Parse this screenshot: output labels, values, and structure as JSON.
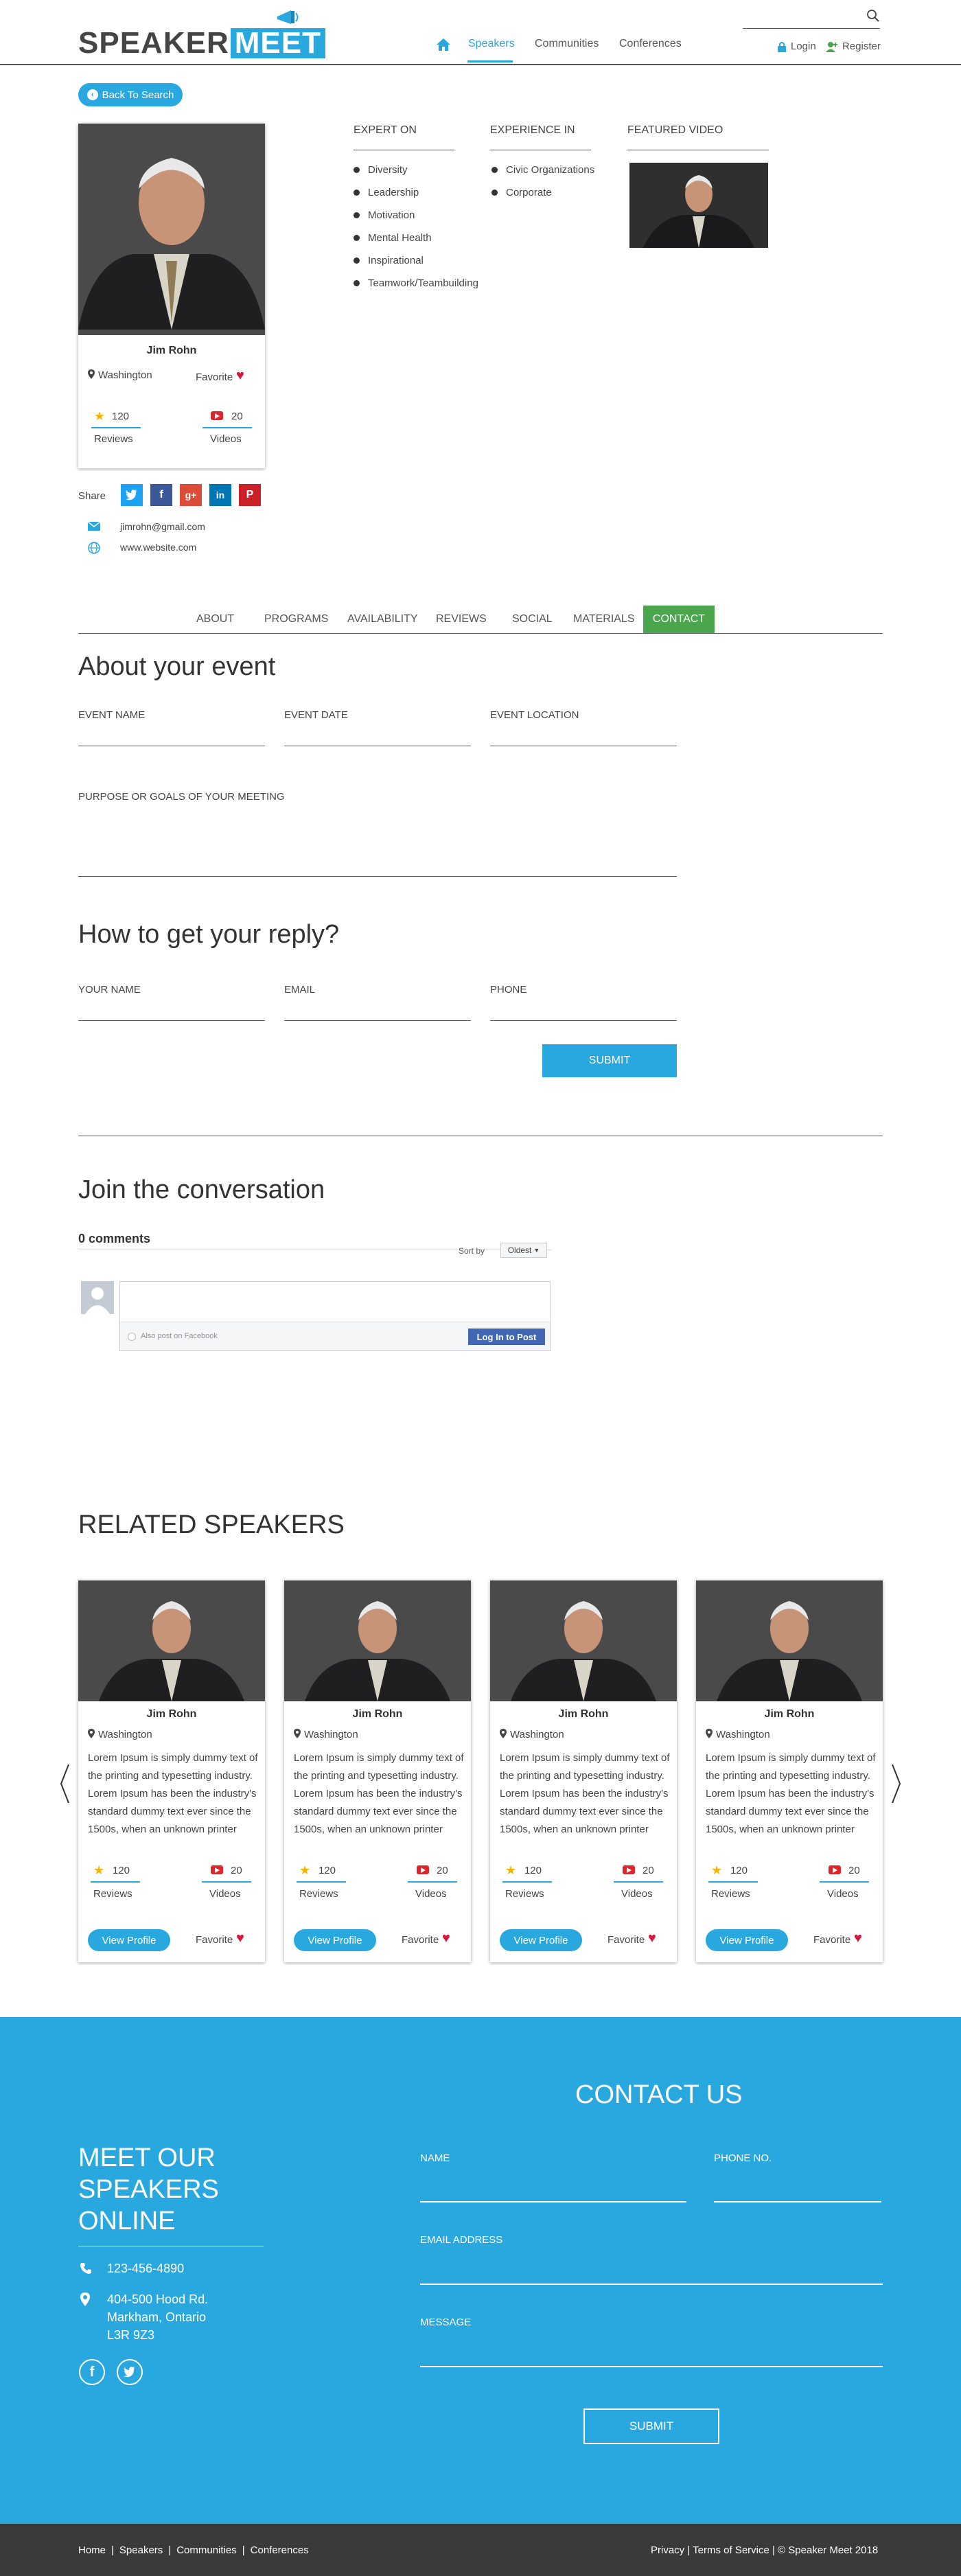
{
  "brand": {
    "part1": "SPEAKER",
    "part2": "MEET"
  },
  "nav": {
    "speakers": "Speakers",
    "communities": "Communities",
    "conferences": "Conferences",
    "login": "Login",
    "register": "Register"
  },
  "back_label": "Back To Search",
  "speaker": {
    "name": "Jim Rohn",
    "location": "Washington",
    "favorite_label": "Favorite",
    "reviews_count": "120",
    "reviews_label": "Reviews",
    "videos_count": "20",
    "videos_label": "Videos",
    "share_label": "Share",
    "email": "jimrohn@gmail.com",
    "website": "www.website.com"
  },
  "expert_on": {
    "title": "EXPERT ON",
    "items": [
      "Diversity",
      "Leadership",
      "Motivation",
      "Mental Health",
      "Inspirational",
      "Teamwork/Teambuilding"
    ]
  },
  "experience_in": {
    "title": "EXPERIENCE IN",
    "items": [
      "Civic Organizations",
      "Corporate"
    ]
  },
  "featured_video": {
    "title": "FEATURED VIDEO"
  },
  "tabs": [
    "ABOUT",
    "PROGRAMS",
    "AVAILABILITY",
    "REVIEWS",
    "SOCIAL",
    "MATERIALS",
    "CONTACT"
  ],
  "contact_form": {
    "about_title": "About your event",
    "event_name": "EVENT NAME",
    "event_date": "EVENT DATE",
    "event_location": "EVENT LOCATION",
    "purpose": "PURPOSE OR GOALS OF YOUR MEETING",
    "reply_title": "How to get your reply?",
    "your_name": "YOUR NAME",
    "email": "EMAIL",
    "phone": "PHONE",
    "submit": "SUBMIT"
  },
  "comments": {
    "title": "Join the conversation",
    "count": "0 comments",
    "sort_label": "Sort by",
    "sort_value": "Oldest",
    "also_post": "Also post on Facebook",
    "login_btn": "Log In to Post"
  },
  "related": {
    "title": "RELATED SPEAKERS",
    "cards": [
      {
        "name": "Jim Rohn",
        "location": "Washington",
        "desc": "Lorem Ipsum is simply dummy text of the printing and typesetting industry. Lorem Ipsum has been the industry's standard dummy text ever since the 1500s, when an unknown printer",
        "reviews": "120",
        "reviews_label": "Reviews",
        "videos": "20",
        "videos_label": "Videos",
        "view_label": "View Profile",
        "favorite_label": "Favorite"
      },
      {
        "name": "Jim Rohn",
        "location": "Washington",
        "desc": "Lorem Ipsum is simply dummy text of the printing and typesetting industry. Lorem Ipsum has been the industry's standard dummy text ever since the 1500s, when an unknown printer",
        "reviews": "120",
        "reviews_label": "Reviews",
        "videos": "20",
        "videos_label": "Videos",
        "view_label": "View Profile",
        "favorite_label": "Favorite"
      },
      {
        "name": "Jim Rohn",
        "location": "Washington",
        "desc": "Lorem Ipsum is simply dummy text of the printing and typesetting industry. Lorem Ipsum has been the industry's standard dummy text ever since the 1500s, when an unknown printer",
        "reviews": "120",
        "reviews_label": "Reviews",
        "videos": "20",
        "videos_label": "Videos",
        "view_label": "View Profile",
        "favorite_label": "Favorite"
      },
      {
        "name": "Jim Rohn",
        "location": "Washington",
        "desc": "Lorem Ipsum is simply dummy text of the printing and typesetting industry. Lorem Ipsum has been the industry's standard dummy text ever since the 1500s, when an unknown printer",
        "reviews": "120",
        "reviews_label": "Reviews",
        "videos": "20",
        "videos_label": "Videos",
        "view_label": "View Profile",
        "favorite_label": "Favorite"
      }
    ]
  },
  "footer": {
    "meet_title_1": "MEET OUR",
    "meet_title_2": "SPEAKERS",
    "meet_title_3": "ONLINE",
    "phone": "123-456-4890",
    "address_1": "404-500 Hood Rd.",
    "address_2": "Markham, Ontario",
    "address_3": "L3R 9Z3",
    "contact_title": "CONTACT US",
    "name_label": "NAME",
    "phone_label": "PHONE NO.",
    "email_label": "EMAIL ADDRESS",
    "message_label": "MESSAGE",
    "submit": "SUBMIT",
    "links": [
      "Home",
      "Speakers",
      "Communities",
      "Conferences"
    ],
    "legal": "Privacy | Terms of Service | © Speaker Meet 2018"
  },
  "colors": {
    "brand_blue": "#29a8e0",
    "contact_tab_green": "#4aa54c",
    "heart_red": "#d6163b",
    "footer_dark": "#3a3a3a"
  }
}
